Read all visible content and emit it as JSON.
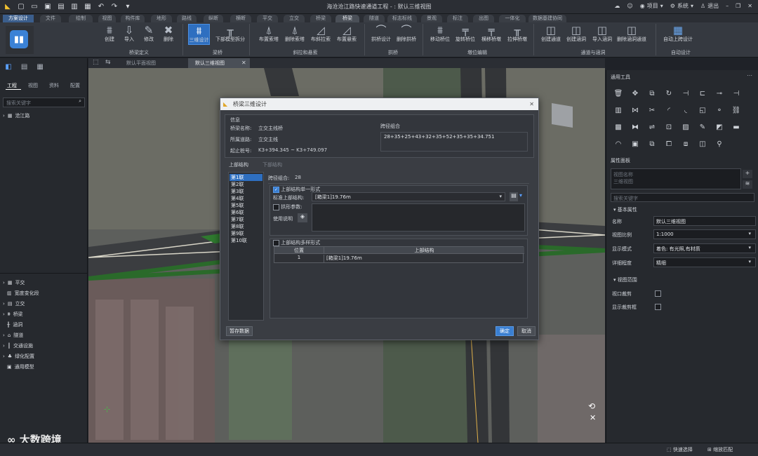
{
  "window": {
    "title": "海沧沧江路快速通道工程 - : 默认三维视图",
    "top_right": {
      "project": "项目",
      "system": "系统",
      "logout": "退出"
    }
  },
  "ribbon_tabs": [
    "方案设计",
    "文件",
    "绘制",
    "视图",
    "构件库",
    "地形",
    "路线",
    "纵断",
    "横断",
    "平交",
    "立交",
    "桥梁",
    "桥梁",
    "隧道",
    "标志标线",
    "景观",
    "标注",
    "出图",
    "一体化",
    "数据基建协同"
  ],
  "ribbon": {
    "buttons": [
      {
        "label": "创建"
      },
      {
        "label": "导入"
      },
      {
        "label": "修改"
      },
      {
        "label": "删除"
      },
      {
        "label": "三维设计"
      },
      {
        "label": "下部模型拆分"
      },
      {
        "label": "布置索塔"
      },
      {
        "label": "删除索塔"
      },
      {
        "label": "布斜拉索"
      },
      {
        "label": "布置悬索"
      },
      {
        "label": "拱桥设计"
      },
      {
        "label": "删除拱桥"
      },
      {
        "label": "移动桥位"
      },
      {
        "label": "旋转桥位"
      },
      {
        "label": "横移桥墩"
      },
      {
        "label": "拉伸桥墩"
      },
      {
        "label": "创建通道"
      },
      {
        "label": "创建涵洞"
      },
      {
        "label": "导入涵洞"
      },
      {
        "label": "删除涵洞通道"
      },
      {
        "label": "自动上跨设计"
      }
    ],
    "groups": [
      "桥梁定义",
      "梁桥",
      "斜拉和悬索",
      "拱桥",
      "墩位编辑",
      "通道与涵洞",
      "自动设计"
    ]
  },
  "left_panel": {
    "subtabs": [
      "工程",
      "视图",
      "资料",
      "配置"
    ],
    "search_placeholder": "搜索关键字",
    "project_root": "沧江路",
    "bottom_tree": [
      "平交",
      "宽度变化段",
      "立交",
      "桥梁",
      "涵洞",
      "隧道",
      "交通设施",
      "绿化配置",
      "通用模型"
    ]
  },
  "view_tabs": [
    "默认平面视图",
    "默认三维视图"
  ],
  "right_panel": {
    "tools_title": "通用工具",
    "props_title": "属性面板",
    "props_placeholder": "视图名称\n三维视图",
    "search_placeholder": "搜索关键字",
    "basic_section": "基本属性",
    "rows": [
      {
        "label": "名称",
        "value": "默认三维视图"
      },
      {
        "label": "视图比例",
        "value": "1:1000"
      },
      {
        "label": "显示模式",
        "value": "着色: 有光照,有材质"
      },
      {
        "label": "详细程度",
        "value": "精细"
      }
    ],
    "range_section": "视图范围",
    "checks": [
      {
        "label": "视口裁剪"
      },
      {
        "label": "显示裁剪框"
      }
    ]
  },
  "statusbar": {
    "quick_select": "快速选择",
    "zoom_fit": "缩放匹配"
  },
  "watermark": "大数跨境",
  "dialog": {
    "title": "桥梁三维设计",
    "info_label": "信息",
    "bridge_name_label": "桥梁名称:",
    "bridge_name": "立交主线桥",
    "route_label": "所属道路:",
    "route": "立交主线",
    "station_label": "起止桩号:",
    "station": "K3+394.345 ~ K3+749.097",
    "span_label": "跨径组合",
    "span_value": "28+35+25+43+32+35+52+35+35+34.751",
    "tab_upper": "上部结构",
    "tab_lower": "下部结构",
    "joints": [
      "第1联",
      "第2联",
      "第3联",
      "第4联",
      "第5联",
      "第6联",
      "第7联",
      "第8联",
      "第9联",
      "第10联"
    ],
    "span_combo_label": "跨径组合:",
    "span_combo_value": "28",
    "single_form_label": "上部结构单一形式",
    "std_upper_label": "标准上部结构:",
    "std_upper_value": "[箱梁1]19.76m",
    "arch_param_label": "拱形参数:",
    "usage_label": "使用说明",
    "multi_form_label": "上部结构多样形式",
    "table_headers": [
      "位置",
      "上部结构"
    ],
    "table_rows": [
      {
        "pos": "1",
        "upper": "[箱梁1]19.76m"
      }
    ],
    "save_label": "暂存数据",
    "ok_label": "确定",
    "cancel_label": "取消"
  }
}
